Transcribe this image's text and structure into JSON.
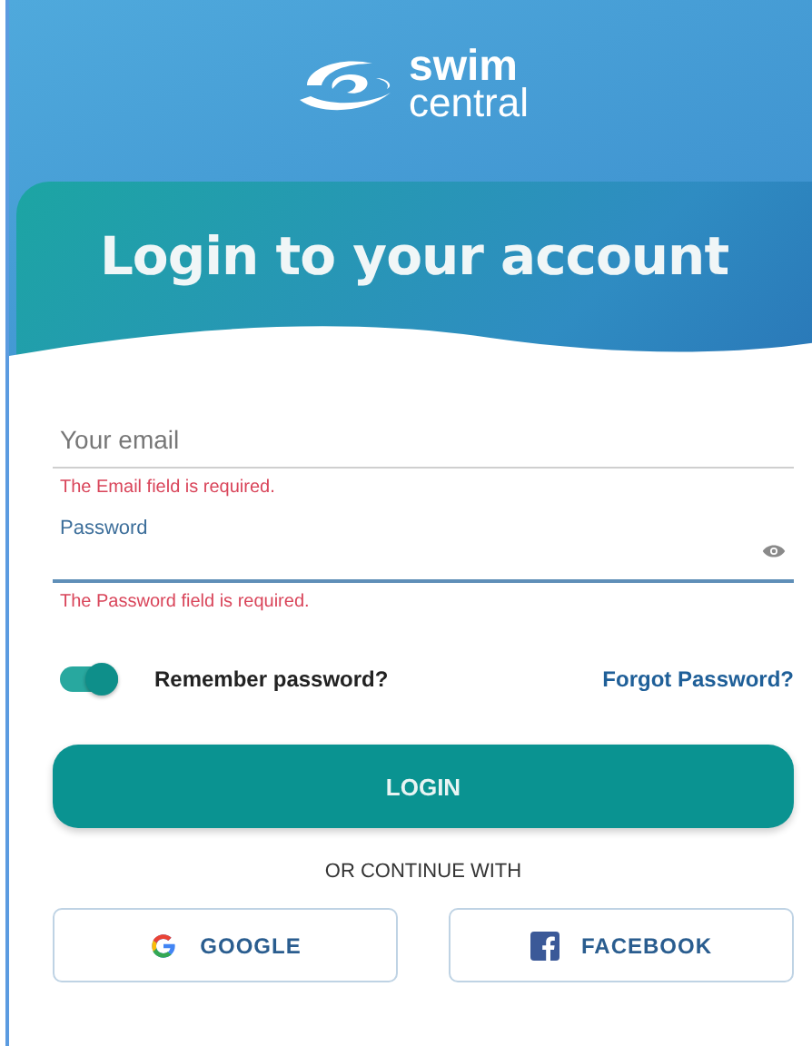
{
  "logo": {
    "line_1": "swim",
    "line_2": "central"
  },
  "title": "Login to your account",
  "email": {
    "placeholder": "Your email",
    "error": "The Email field is required."
  },
  "password": {
    "label": "Password",
    "error": "The Password field is required."
  },
  "remember": {
    "label": "Remember password?",
    "on": true
  },
  "forgot_link": "Forgot Password?",
  "login_button": "LOGIN",
  "divider_text": "OR CONTINUE WITH",
  "social_buttons": [
    {
      "kind": "google",
      "label": "GOOGLE"
    },
    {
      "kind": "facebook",
      "label": "FACEBOOK"
    }
  ]
}
